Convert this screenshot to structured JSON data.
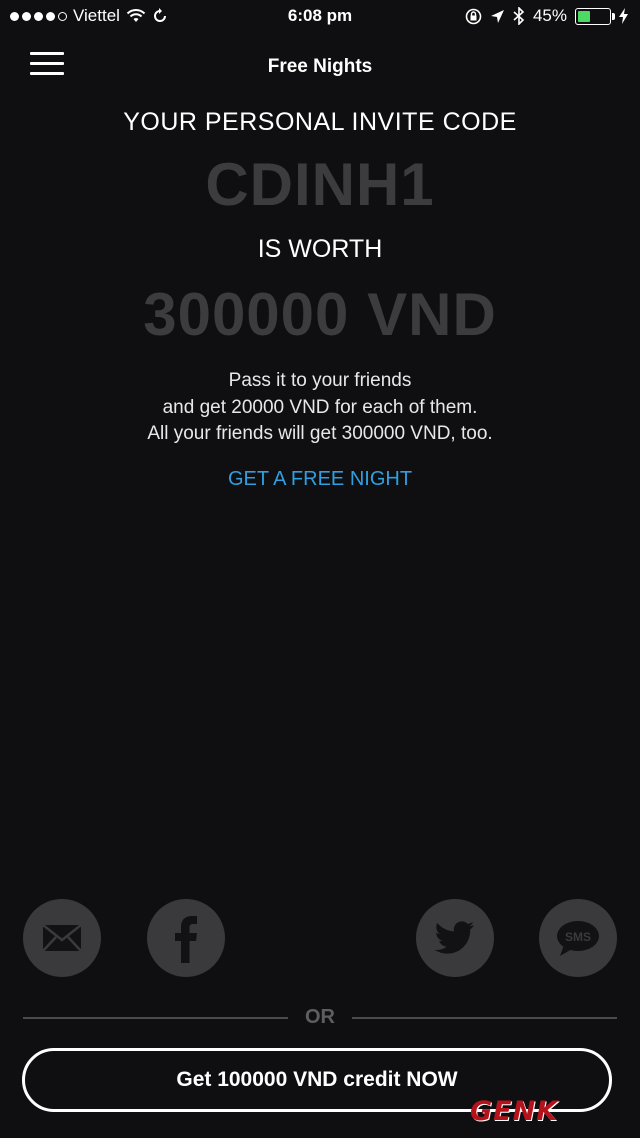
{
  "status_bar": {
    "carrier": "Viettel",
    "time": "6:08 pm",
    "battery_percent": "45%",
    "battery_level": 0.45,
    "signal_bars": 4,
    "signal_total": 5
  },
  "header": {
    "title": "Free Nights",
    "menu_icon": "hamburger-menu-icon"
  },
  "main": {
    "heading": "YOUR PERSONAL INVITE CODE",
    "code": "CDINH1",
    "worth_label": "IS WORTH",
    "worth_value": "300000 VND",
    "description": [
      "Pass it to your friends",
      "and get 20000 VND for each of them.",
      "All your friends will get 300000 VND, too."
    ],
    "link_label": "GET A FREE NIGHT"
  },
  "share": {
    "icons": [
      "mail-icon",
      "facebook-icon",
      "twitter-icon",
      "sms-icon"
    ],
    "sms_label": "SMS"
  },
  "divider": {
    "label": "OR"
  },
  "cta": {
    "label": "Get 100000 VND credit NOW"
  },
  "watermark": {
    "text": "GENK"
  },
  "colors": {
    "background": "#0f0f11",
    "accent_link": "#2f9fe0",
    "muted_code": "#3c3c3e",
    "share_circle": "#3a3a3c",
    "battery": "#4cd964"
  }
}
